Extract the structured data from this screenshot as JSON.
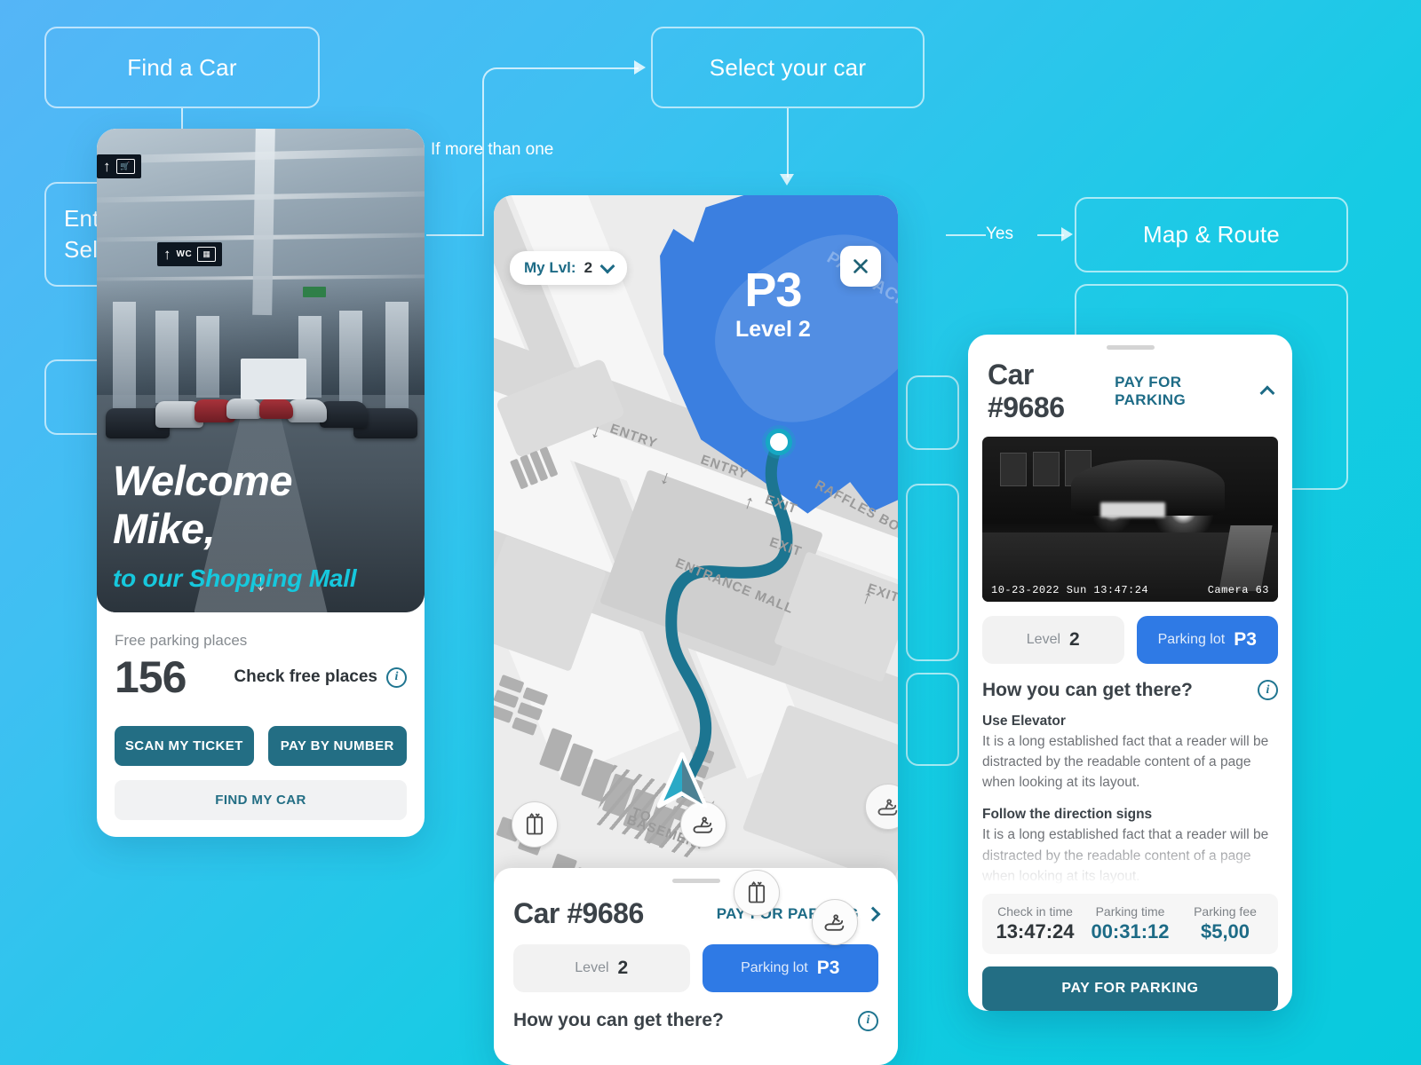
{
  "flowchart": {
    "boxes": [
      {
        "label": "Find a Car"
      },
      {
        "label": "Enter car number\nSelect your car"
      },
      {
        "label": "Select your car"
      },
      {
        "label": "Map & Route"
      },
      {
        "label": ""
      },
      {
        "label": ""
      },
      {
        "label": ""
      },
      {
        "label": ""
      },
      {
        "label": ""
      }
    ],
    "connector_labels": {
      "more_than_one": "If more than one",
      "yes": "Yes"
    }
  },
  "welcome_screen": {
    "hero": {
      "welcome_line1": "Welcome",
      "welcome_line2": "Mike,",
      "subtitle": "to our Shopping Mall",
      "sign_wc": "WC"
    },
    "free_places_label": "Free parking places",
    "free_places_count": "156",
    "check_free_places": "Check free places",
    "info_icon": "i",
    "buttons": {
      "scan": "SCAN MY TICKET",
      "pay_by_number": "PAY BY NUMBER",
      "find_my_car": "FIND MY CAR"
    }
  },
  "map_screen": {
    "level_chip": {
      "prefix": "My Lvl:",
      "value": "2"
    },
    "close_icon": "close-icon",
    "zone": {
      "code": "P3",
      "level": "Level 2",
      "watermark": "PAN PACIFIC SINGAPORE"
    },
    "map_words": {
      "entry_1": "ENTRY",
      "entry_2": "ENTRY",
      "exit_1": "EXIT",
      "exit_2": "EXIT",
      "exit_3": "EXIT",
      "boulevard": "RAFFLES BOULEVARD",
      "entrance_mall": "ENTRANCE MALL",
      "to_basement_1": "TO",
      "to_basement_2": "BASEMENT"
    },
    "sheet": {
      "car_id": "Car #9686",
      "pay_link": "PAY FOR PARKING",
      "level_label": "Level",
      "level_value": "2",
      "lot_label": "Parking lot",
      "lot_value": "P3",
      "how_title": "How you can get there?",
      "info_icon": "i"
    }
  },
  "detail_screen": {
    "car_id": "Car #9686",
    "pay_link": "PAY FOR PARKING",
    "cctv": {
      "timestamp": "10-23-2022 Sun 13:47:24",
      "camera": "Camera 63"
    },
    "level_label": "Level",
    "level_value": "2",
    "lot_label": "Parking lot",
    "lot_value": "P3",
    "how_title": "How you can get there?",
    "info_icon": "i",
    "steps": [
      {
        "title": "Use Elevator",
        "text": "It is a long established fact that a reader will be distracted by the readable content of a page when looking at its layout."
      },
      {
        "title": "Follow the direction signs",
        "text": "It is a long established fact that a reader will be distracted by the readable content of a page when looking at its layout."
      }
    ],
    "stats": [
      {
        "key": "Check in time",
        "value": "13:47:24"
      },
      {
        "key": "Parking time",
        "value": "00:31:12"
      },
      {
        "key": "Parking fee",
        "value": "$5,00"
      }
    ],
    "pay_button": "PAY FOR PARKING"
  },
  "colors": {
    "bg_from": "#55b5f7",
    "bg_to": "#08cadd",
    "accent_teal": "#236e84",
    "accent_cyan": "#16c8dd",
    "zone_blue": "#3b7fe0",
    "route": "#1c7591"
  }
}
